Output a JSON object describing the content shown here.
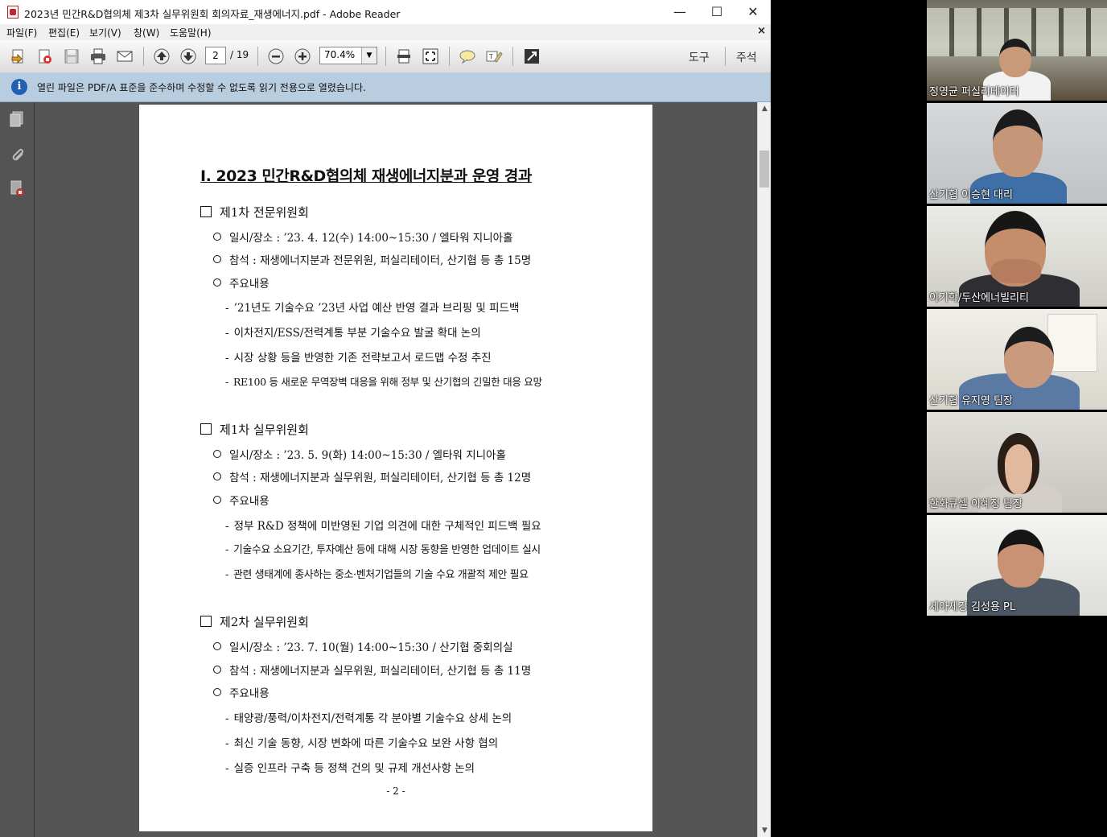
{
  "window": {
    "title": "2023년 민간R&D협의체 제3차 실무위원회 회의자료_재생에너지.pdf - Adobe Reader",
    "min": "—",
    "max": "☐",
    "close": "✕"
  },
  "menu": {
    "items": [
      "파일(F)",
      "편집(E)",
      "보기(V)",
      "창(W)",
      "도움말(H)"
    ],
    "close": "×"
  },
  "toolbar": {
    "page_current": "2",
    "page_total": "/ 19",
    "zoom": "70.4%",
    "zoom_arrow": "▼",
    "tools_label": "도구",
    "comment_label": "주석"
  },
  "infobar": {
    "icon": "i",
    "text": "열린 파일은 PDF/A 표준을 준수하며 수정할 수 없도록 읽기 전용으로 열렸습니다."
  },
  "scrollbar": {
    "up": "▲",
    "down": "▼"
  },
  "document": {
    "title": "Ⅰ. 2023 민간R&D협의체 재생에너지분과 운영 경과",
    "sections": [
      {
        "heading": "제1차 전문위원회",
        "datetime": "일시/장소 : ’23. 4. 12(수) 14:00~15:30 / 엘타워 지니아홀",
        "attendees": "참석 : 재생에너지분과 전문위원, 퍼실리테이터, 산기협 등 총 15명",
        "content_label": "주요내용",
        "items": [
          "’21년도 기술수요 ’23년 사업 예산 반영 결과 브리핑 및 피드백",
          "이차전지/ESS/전력계통 부분 기술수요 발굴 확대 논의",
          "시장 상황 등을 반영한 기존 전략보고서 로드맵 수정 추진",
          "RE100 등 새로운 무역장벽 대응을 위해 정부 및 산기협의 긴밀한 대응 요망"
        ]
      },
      {
        "heading": "제1차 실무위원회",
        "datetime": "일시/장소 : ’23. 5. 9(화) 14:00~15:30 / 엘타워 지니아홀",
        "attendees": "참석 : 재생에너지분과 실무위원, 퍼실리테이터, 산기협 등 총 12명",
        "content_label": "주요내용",
        "items": [
          "정부 R&D 정책에 미반영된 기업 의견에 대한 구체적인 피드백 필요",
          "기술수요 소요기간, 투자예산 등에 대해 시장 동향을 반영한 업데이트 실시",
          "관련 생태계에 종사하는 중소·벤처기업들의 기술 수요 개괄적 제안 필요"
        ]
      },
      {
        "heading": "제2차 실무위원회",
        "datetime": "일시/장소 : ’23. 7. 10(월) 14:00~15:30 / 산기협 중회의실",
        "attendees": "참석 : 재생에너지분과 실무위원, 퍼실리테이터, 산기협 등 총 11명",
        "content_label": "주요내용",
        "items": [
          "태양광/풍력/이차전지/전력계통 각 분야별 기술수요 상세 논의",
          "최신 기술 동향, 시장 변화에 따른 기술수요 보완 사항 협의",
          "실증 인프라 구축 등 정책 건의 및 규제 개선사항 논의"
        ]
      }
    ],
    "page_number": "- 2 -"
  },
  "participants": [
    "정영균 퍼실리테이터",
    "산기협 이승현 대리",
    "이기학/두산에너빌리티",
    "산기협 유지영 팀장",
    "한화큐셀 이혜정 팀장",
    "세아제강 김성용 PL"
  ]
}
